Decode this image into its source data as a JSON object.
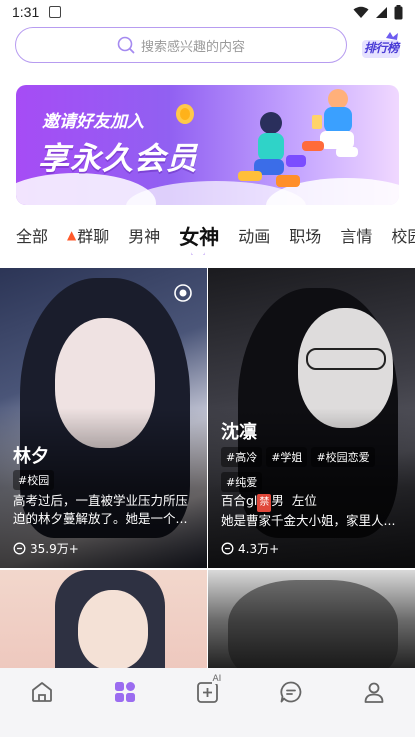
{
  "status_bar": {
    "time": "1:31"
  },
  "search": {
    "placeholder": "搜索感兴趣的内容"
  },
  "rank_button": {
    "label": "排行榜"
  },
  "banner": {
    "line1": "邀请好友加入",
    "line2": "享永久会员"
  },
  "tabs": [
    {
      "label": "全部",
      "active": false
    },
    {
      "label": "群聊",
      "active": false,
      "icon": "fire-icon"
    },
    {
      "label": "男神",
      "active": false
    },
    {
      "label": "女神",
      "active": true
    },
    {
      "label": "动画",
      "active": false
    },
    {
      "label": "职场",
      "active": false
    },
    {
      "label": "言情",
      "active": false
    },
    {
      "label": "校园",
      "active": false
    }
  ],
  "cards": [
    {
      "name": "林夕",
      "tags": [
        "#校园"
      ],
      "description": "高考过后，一直被学业压力所压迫的林夕蔓解放了。她是一个...",
      "chat_count": "35.9万+"
    },
    {
      "name": "沈凛",
      "tags": [
        "#高冷",
        "#学姐",
        "#校园恋爱",
        "#纯爱"
      ],
      "description_part1": "百合gl",
      "description_ban": "禁",
      "description_part2": "男  左位",
      "description_line2": "她是曹家千金大小姐，家里人...",
      "chat_count": "4.3万+"
    }
  ],
  "colors": {
    "accent": "#9b6cf0",
    "search_border": "#b79cf0",
    "nav_active": "#9b6cf0",
    "nav_inactive": "#666666"
  },
  "nav": [
    {
      "icon": "home-icon",
      "active": false
    },
    {
      "icon": "discover-grid-icon",
      "active": true
    },
    {
      "icon": "ai-create-icon",
      "active": false
    },
    {
      "icon": "chat-icon",
      "active": false
    },
    {
      "icon": "profile-icon",
      "active": false
    }
  ],
  "nav_ai_badge": "AI"
}
